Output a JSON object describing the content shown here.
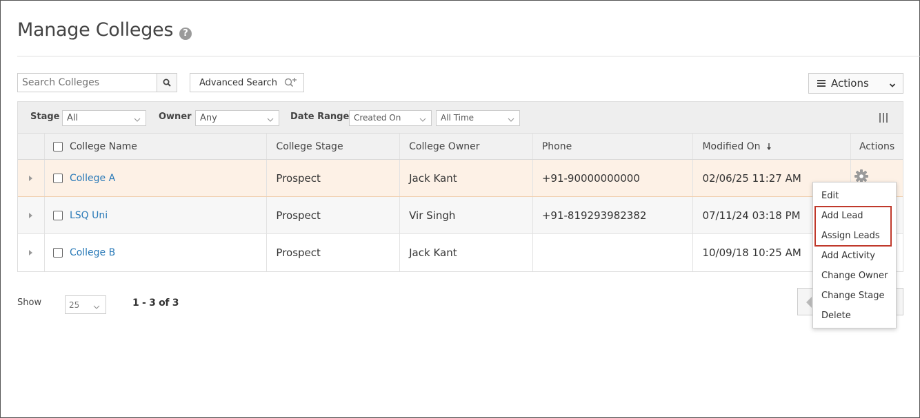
{
  "page": {
    "title": "Manage Colleges"
  },
  "search": {
    "placeholder": "Search Colleges"
  },
  "toolbar": {
    "advanced_search_label": "Advanced Search",
    "actions_label": "Actions"
  },
  "filters": {
    "stage": {
      "label": "Stage",
      "value": "All"
    },
    "owner": {
      "label": "Owner",
      "value": "Any"
    },
    "date_range": {
      "label": "Date Range",
      "field": "Created On",
      "period": "All Time"
    }
  },
  "table": {
    "headers": {
      "name": "College Name",
      "stage": "College Stage",
      "owner": "College Owner",
      "phone": "Phone",
      "modified": "Modified On",
      "actions": "Actions"
    },
    "rows": [
      {
        "name": "College A",
        "stage": "Prospect",
        "owner": "Jack Kant",
        "phone": "+91-90000000000",
        "modified": "02/06/25 11:27 AM"
      },
      {
        "name": "LSQ Uni",
        "stage": "Prospect",
        "owner": "Vir Singh",
        "phone": "+91-819293982382",
        "modified": "07/11/24 03:18 PM"
      },
      {
        "name": "College B",
        "stage": "Prospect",
        "owner": "Jack Kant",
        "phone": "",
        "modified": "10/09/18 10:25 AM"
      }
    ]
  },
  "pagination": {
    "show_label": "Show",
    "page_size": "25",
    "count_text": "1 - 3 of 3"
  },
  "row_menu": {
    "items": [
      "Edit",
      "Add Lead",
      "Assign Leads",
      "Add Activity",
      "Change Owner",
      "Change Stage",
      "Delete"
    ]
  },
  "colors": {
    "link": "#2a7ab8",
    "highlight_row": "#fdf1e6",
    "annotation_box": "#c0392b"
  }
}
